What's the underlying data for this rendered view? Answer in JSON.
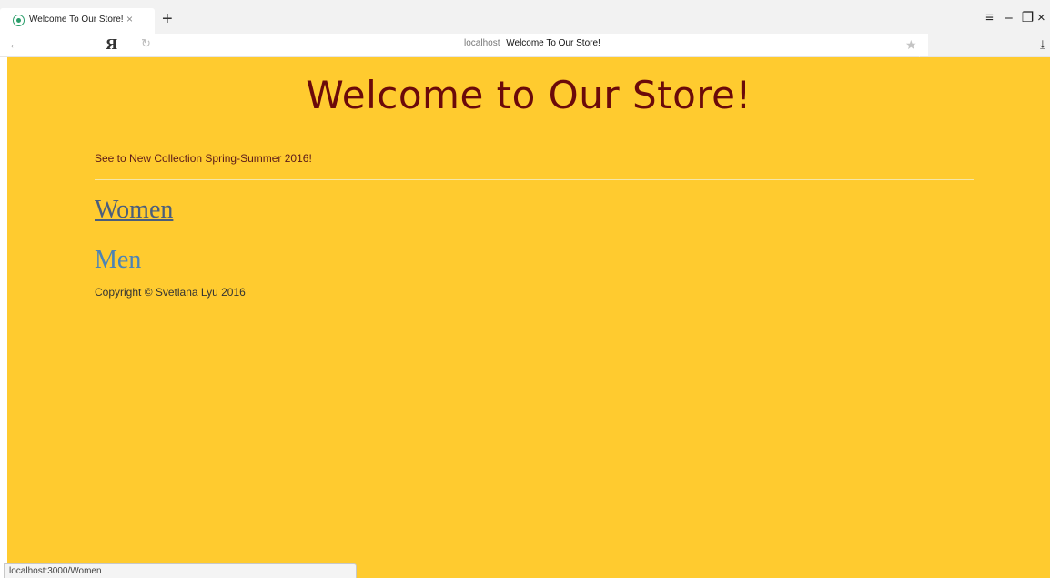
{
  "browser": {
    "tab_title": "Welcome To Our Store!",
    "tab_close": "×",
    "new_tab": "+",
    "back": "←",
    "yandex_logo": "Я",
    "reload": "↻",
    "address_host": "localhost",
    "address_title": "Welcome To Our Store!",
    "bookmark": "★",
    "download": "⤓",
    "menu": "≡",
    "minimize": "–",
    "restore": "❐",
    "close": "×",
    "status_url": "localhost:3000/Women"
  },
  "page": {
    "heading": "Welcome to Our Store!",
    "promo": "See to New Collection Spring-Summer 2016!",
    "nav": {
      "women": "Women",
      "men": "Men"
    },
    "copyright": "Copyright © Svetlana Lyu 2016"
  },
  "colors": {
    "background": "#ffcb2f",
    "heading": "#6b0a0a",
    "link_visited": "#4a5e7c",
    "link": "#4d84b5"
  }
}
